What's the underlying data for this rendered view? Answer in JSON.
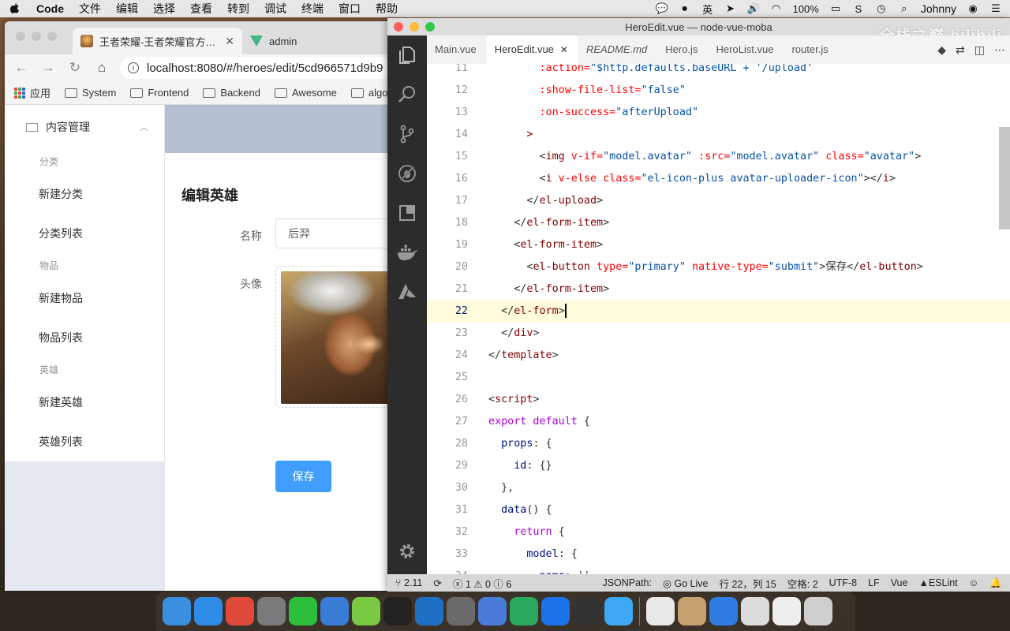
{
  "menubar": {
    "app": "Code",
    "items": [
      "文件",
      "编辑",
      "选择",
      "查看",
      "转到",
      "调试",
      "终端",
      "窗口",
      "帮助"
    ],
    "battery": "100%",
    "user": "Johnny",
    "input_method": "英"
  },
  "chrome": {
    "tabs": [
      {
        "title": "王者荣耀-王者荣耀官方网站",
        "icon": "hero-favicon"
      },
      {
        "title": "admin",
        "icon": "vue-favicon"
      }
    ],
    "url": "localhost:8080/#/heroes/edit/5cd966571d9b9",
    "bookmarks": [
      "应用",
      "System",
      "Frontend",
      "Backend",
      "Awesome",
      "algo"
    ]
  },
  "admin": {
    "menu_title": "内容管理",
    "groups": [
      {
        "label": "分类",
        "items": [
          "新建分类",
          "分类列表"
        ]
      },
      {
        "label": "物品",
        "items": [
          "新建物品",
          "物品列表"
        ]
      },
      {
        "label": "英雄",
        "items": [
          "新建英雄",
          "英雄列表"
        ]
      }
    ],
    "page_title": "编辑英雄",
    "name_label": "名称",
    "name_value": "后羿",
    "avatar_label": "头像",
    "save_label": "保存",
    "primary_color": "#409eff"
  },
  "vscode": {
    "title": "HeroEdit.vue — node-vue-moba",
    "watermark": "全栈之巅 bilibili",
    "tabs": [
      "Main.vue",
      "HeroEdit.vue",
      "README.md",
      "Hero.js",
      "HeroList.vue",
      "router.js"
    ],
    "active_tab": "HeroEdit.vue",
    "activity_icons": [
      "explorer-icon",
      "search-icon",
      "source-control-icon",
      "debug-icon",
      "extensions-icon",
      "docker-icon",
      "azure-icon"
    ],
    "code_lines": [
      {
        "n": "11",
        "indent": "        ",
        "parts": [
          [
            "attr",
            ":action="
          ],
          [
            "str",
            "\"$http.defaults.baseURL + '/upload'"
          ]
        ]
      },
      {
        "n": "12",
        "indent": "        ",
        "parts": [
          [
            "attr",
            ":show-file-list="
          ],
          [
            "str",
            "\"false\""
          ]
        ]
      },
      {
        "n": "13",
        "indent": "        ",
        "parts": [
          [
            "attr",
            ":on-success="
          ],
          [
            "str",
            "\"afterUpload\""
          ]
        ]
      },
      {
        "n": "14",
        "indent": "      ",
        "parts": [
          [
            "tag",
            ">"
          ]
        ]
      },
      {
        "n": "15",
        "indent": "        ",
        "parts": [
          [
            "pun",
            "<"
          ],
          [
            "tag",
            "img"
          ],
          [
            "attr",
            " v-if="
          ],
          [
            "str",
            "\"model.avatar\""
          ],
          [
            "attr",
            " :src="
          ],
          [
            "str",
            "\"model.avatar\""
          ],
          [
            "attr",
            " class="
          ],
          [
            "str",
            "\"avatar\""
          ],
          [
            "pun",
            ">"
          ]
        ]
      },
      {
        "n": "16",
        "indent": "        ",
        "parts": [
          [
            "pun",
            "<"
          ],
          [
            "tag",
            "i"
          ],
          [
            "attr",
            " v-else class="
          ],
          [
            "str",
            "\"el-icon-plus avatar-uploader-icon\""
          ],
          [
            "pun",
            "></"
          ],
          [
            "tag",
            "i"
          ],
          [
            "pun",
            ">"
          ]
        ]
      },
      {
        "n": "17",
        "indent": "      ",
        "parts": [
          [
            "pun",
            "</"
          ],
          [
            "tag",
            "el-upload"
          ],
          [
            "pun",
            ">"
          ]
        ]
      },
      {
        "n": "18",
        "indent": "    ",
        "parts": [
          [
            "pun",
            "</"
          ],
          [
            "tag",
            "el-form-item"
          ],
          [
            "pun",
            ">"
          ]
        ]
      },
      {
        "n": "19",
        "indent": "    ",
        "parts": [
          [
            "pun",
            "<"
          ],
          [
            "tag",
            "el-form-item"
          ],
          [
            "pun",
            ">"
          ]
        ]
      },
      {
        "n": "20",
        "indent": "      ",
        "parts": [
          [
            "pun",
            "<"
          ],
          [
            "tag",
            "el-button"
          ],
          [
            "attr",
            " type="
          ],
          [
            "str",
            "\"primary\""
          ],
          [
            "attr",
            " native-type="
          ],
          [
            "str",
            "\"submit\""
          ],
          [
            "pun",
            ">保存</"
          ],
          [
            "tag",
            "el-button"
          ],
          [
            "pun",
            ">"
          ]
        ]
      },
      {
        "n": "21",
        "indent": "    ",
        "parts": [
          [
            "pun",
            "</"
          ],
          [
            "tag",
            "el-form-item"
          ],
          [
            "pun",
            ">"
          ]
        ]
      },
      {
        "n": "22",
        "indent": "  ",
        "parts": [
          [
            "pun",
            "</"
          ],
          [
            "tag",
            "el-form"
          ],
          [
            "pun",
            ">"
          ]
        ],
        "current": true
      },
      {
        "n": "23",
        "indent": "  ",
        "parts": [
          [
            "pun",
            "</"
          ],
          [
            "tag",
            "div"
          ],
          [
            "pun",
            ">"
          ]
        ]
      },
      {
        "n": "24",
        "indent": "",
        "parts": [
          [
            "pun",
            "</"
          ],
          [
            "tag",
            "template"
          ],
          [
            "pun",
            ">"
          ]
        ]
      },
      {
        "n": "25",
        "indent": "",
        "parts": []
      },
      {
        "n": "26",
        "indent": "",
        "parts": [
          [
            "pun",
            "<"
          ],
          [
            "tag",
            "script"
          ],
          [
            "pun",
            ">"
          ]
        ]
      },
      {
        "n": "27",
        "indent": "",
        "parts": [
          [
            "kw",
            "export default"
          ],
          [
            "pun",
            " {"
          ]
        ]
      },
      {
        "n": "28",
        "indent": "  ",
        "parts": [
          [
            "prop",
            "props"
          ],
          [
            "pun",
            ": {"
          ]
        ]
      },
      {
        "n": "29",
        "indent": "    ",
        "parts": [
          [
            "prop",
            "id"
          ],
          [
            "pun",
            ": {}"
          ]
        ]
      },
      {
        "n": "30",
        "indent": "  ",
        "parts": [
          [
            "pun",
            "},"
          ]
        ]
      },
      {
        "n": "31",
        "indent": "  ",
        "parts": [
          [
            "prop",
            "data"
          ],
          [
            "pun",
            "() {"
          ]
        ]
      },
      {
        "n": "32",
        "indent": "    ",
        "parts": [
          [
            "kw",
            "return"
          ],
          [
            "pun",
            " {"
          ]
        ]
      },
      {
        "n": "33",
        "indent": "      ",
        "parts": [
          [
            "prop",
            "model"
          ],
          [
            "pun",
            ": {"
          ]
        ]
      },
      {
        "n": "34",
        "indent": "        ",
        "parts": [
          [
            "prop",
            "name"
          ],
          [
            "pun",
            ": ''"
          ],
          [
            "pun",
            ","
          ]
        ]
      }
    ],
    "status": {
      "branch": "2.11",
      "errors": "1",
      "warnings": "0",
      "info": "6",
      "json_path": "JSONPath:",
      "go_live": "Go Live",
      "position": "行 22，列 15",
      "spaces": "空格: 2",
      "encoding": "UTF-8",
      "eol": "LF",
      "language": "Vue",
      "eslint": "ESLint"
    }
  },
  "dock": {
    "apps": [
      {
        "name": "finder-icon",
        "color": "#3b8fe0"
      },
      {
        "name": "safari-icon",
        "color": "#2e8be6"
      },
      {
        "name": "chrome-icon",
        "color": "#e04a3a"
      },
      {
        "name": "system-preferences-icon",
        "color": "#7a7a7a"
      },
      {
        "name": "wechat-icon",
        "color": "#2dbf3b"
      },
      {
        "name": "xcode-icon",
        "color": "#3a7bd5"
      },
      {
        "name": "mindnode-icon",
        "color": "#7ac943"
      },
      {
        "name": "terminal-icon",
        "color": "#222222"
      },
      {
        "name": "vscode-icon",
        "color": "#1f6fc5"
      },
      {
        "name": "photo-icon",
        "color": "#6b6b6b"
      },
      {
        "name": "activity-monitor-icon",
        "color": "#4a7bd8"
      },
      {
        "name": "vpn-icon",
        "color": "#2aa85e"
      },
      {
        "name": "teamviewer-icon",
        "color": "#1a73e8"
      },
      {
        "name": "stocks-icon",
        "color": "#333333"
      },
      {
        "name": "feishu-icon",
        "color": "#3da8f5"
      },
      {
        "name": "textedit-icon",
        "color": "#e8e8e8"
      },
      {
        "name": "archive-icon",
        "color": "#c8a070"
      },
      {
        "name": "wps-icon",
        "color": "#2f7de1"
      },
      {
        "name": "preview-icon",
        "color": "#dcdcdc"
      },
      {
        "name": "screenshot-icon",
        "color": "#eeeeee"
      },
      {
        "name": "trash-icon",
        "color": "#cfcfcf"
      }
    ]
  }
}
